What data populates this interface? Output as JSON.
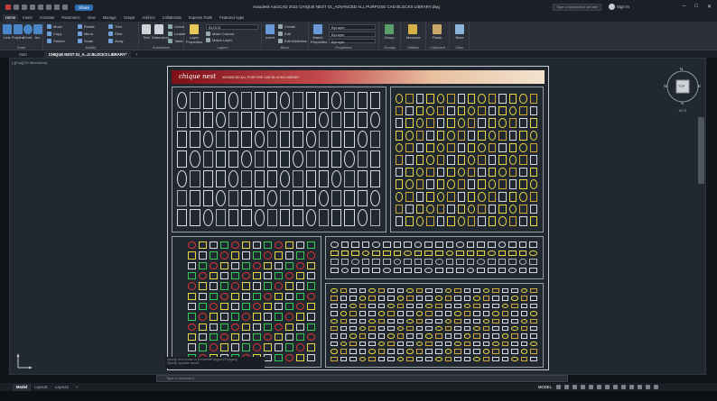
{
  "titlebar": {
    "title": "Autodesk AutoCAD 2022   CHIQUE NEST 01_ADVANCED ALL PURPOSE CAD BLOCKS LIBRARY.dwg",
    "share": "Share",
    "search_placeholder": "Type a keyword or phrase",
    "signin": "Sign In",
    "minimize": "–",
    "maximize": "□",
    "close": "✕"
  },
  "ribbon_tabs": [
    "Home",
    "Insert",
    "Annotate",
    "Parametric",
    "View",
    "Manage",
    "Output",
    "Add-ins",
    "Collaborate",
    "Express Tools",
    "Featured Apps"
  ],
  "ribbon": {
    "draw": {
      "label": "Draw",
      "line": "Line",
      "polyline": "Polyline",
      "circle": "Circle",
      "arc": "Arc"
    },
    "modify": {
      "label": "Modify",
      "items": [
        "Move",
        "Rotate",
        "Trim",
        "Copy",
        "Mirror",
        "Fillet",
        "Stretch",
        "Scale",
        "Array"
      ]
    },
    "annotation": {
      "label": "Annotation",
      "text": "Text",
      "dimension": "Dimension",
      "linear": "Linear",
      "leader": "Leader",
      "table": "Table"
    },
    "layers": {
      "label": "Layers",
      "layer_properties": "Layer Properties",
      "current_layer": "BLOCK",
      "make_current": "Make Current",
      "match_layer": "Match Layer"
    },
    "block": {
      "label": "Block",
      "insert": "Insert",
      "create": "Create",
      "edit": "Edit",
      "edit_attributes": "Edit Attributes"
    },
    "properties": {
      "label": "Properties",
      "match_properties": "Match Properties",
      "bylayer1": "ByLayer",
      "bylayer2": "ByLayer",
      "bylayer3": "ByLayer"
    },
    "groups": {
      "label": "Groups",
      "group": "Group"
    },
    "utilities": {
      "label": "Utilities",
      "measure": "Measure"
    },
    "clipboard": {
      "label": "Clipboard",
      "paste": "Paste"
    },
    "view": {
      "label": "View",
      "base": "Base"
    }
  },
  "doc_tabs": {
    "start": "Start",
    "active": "CHIQUE NEST 01_A...D BLOCKS LIBRARY*",
    "add": "+"
  },
  "viewport": {
    "label": "[-][Top][2D Wireframe]",
    "sheet": {
      "logo": "chique nest",
      "subtitle": "ADVANCED ALL PURPOSE CAD BLOCKS LIBRARY"
    }
  },
  "viewcube": {
    "n": "N",
    "s": "S",
    "e": "E",
    "w": "W",
    "top": "TOP",
    "wcs": "WCS"
  },
  "command": {
    "history": [
      "Specify next corner or [Fence/WPolygon/CPolygon]:",
      "Specify opposite corner:"
    ],
    "placeholder": "Type a command"
  },
  "layout_tabs": [
    "Model",
    "Layout1",
    "Layout2"
  ],
  "layout_add": "+",
  "status": {
    "model": "MODEL"
  },
  "colors": {
    "accent": "#2d6fb5",
    "bg": "#212830",
    "cad_yellow": "#e8d844",
    "cad_green": "#33cc55",
    "cad_red": "#dd3333",
    "cad_white": "#d8dce0"
  }
}
